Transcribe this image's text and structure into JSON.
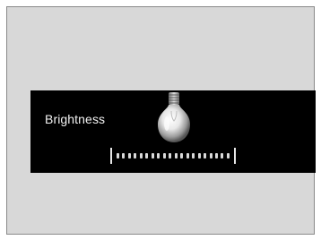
{
  "brightness": {
    "label": "Brightness",
    "icon": "light-bulb-icon",
    "slider_level": 1.0,
    "slider_segments": 20
  },
  "colors": {
    "background": "#d8d8d8",
    "panel": "#000000",
    "text": "#f2f2f2",
    "slider": "#d9d9d9"
  }
}
